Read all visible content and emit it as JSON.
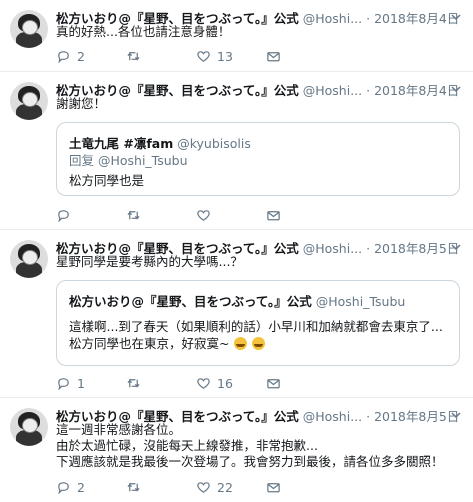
{
  "tweets": [
    {
      "name": "松方いおり@『星野、目をつぶって。』公式",
      "handle": "@Hoshi...",
      "sep": "·",
      "date": "2018年8月4日",
      "text": [
        "真的好熱...各位也請注意身體！"
      ],
      "replies": "2",
      "retweets": "",
      "likes": "13"
    },
    {
      "name": "松方いおり@『星野、目をつぶって。』公式",
      "handle": "@Hoshi...",
      "sep": "·",
      "date": "2018年8月4日",
      "text": [
        "謝謝您！"
      ],
      "quote": {
        "name": "土竜九尾 #凛fam",
        "handle": "@kyubisolis",
        "reply_to": "回复 @Hoshi_Tsubu",
        "text": "松方同學也是"
      },
      "replies": "",
      "retweets": "",
      "likes": ""
    },
    {
      "name": "松方いおり@『星野、目をつぶって。』公式",
      "handle": "@Hoshi...",
      "sep": "·",
      "date": "2018年8月5日",
      "text": [
        "星野同學是要考縣內的大學嗎...？"
      ],
      "quote": {
        "name": "松方いおり@『星野、目をつぶって。』公式",
        "handle": "@Hoshi_Tsubu",
        "line1": "這樣啊...到了春天（如果順利的話）小早川和加納就都會去東京了...",
        "line2": "松方同學也在東京，好寂寞~"
      },
      "replies": "1",
      "retweets": "",
      "likes": "16"
    },
    {
      "name": "松方いおり@『星野、目をつぶって。』公式",
      "handle": "@Hoshi...",
      "sep": "·",
      "date": "2018年8月5日",
      "text": [
        "這一週非常感謝各位。",
        "由於太過忙碌，沒能每天上線發推，非常抱歉...",
        "下週應該就是我最後一次登場了。我會努力到最後，請各位多多關照！"
      ],
      "replies": "2",
      "retweets": "",
      "likes": "22"
    }
  ]
}
